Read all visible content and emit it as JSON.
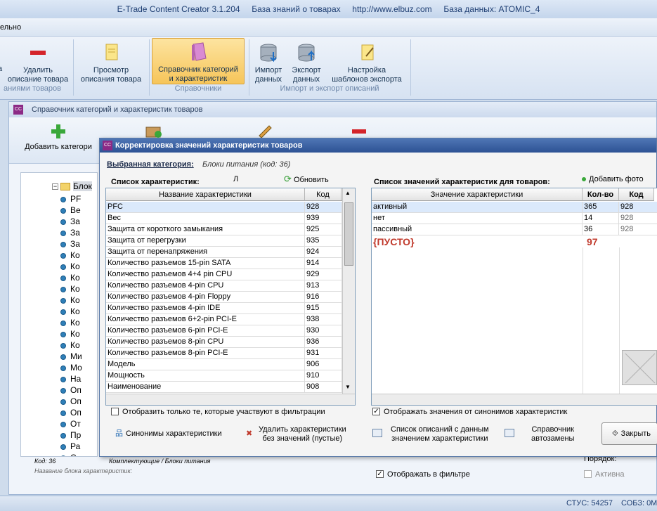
{
  "window": {
    "title": "E-Trade Content Creator 3.1.204     База знаний о товарах     http://www.elbuz.com     База данных: ATOMIC_4"
  },
  "menu": {
    "item": "ельно"
  },
  "ribbon": {
    "buttons": [
      {
        "label": "а",
        "icon": "partial-icon"
      },
      {
        "label": "Удалить\nописание товара",
        "icon": "minus-icon"
      },
      {
        "label": "Просмотр\nописания товара",
        "icon": "document-icon"
      },
      {
        "label": "Справочник категорий\nи характеристик",
        "icon": "book-icon"
      },
      {
        "label": "Импорт\nданных",
        "icon": "database-import-icon"
      },
      {
        "label": "Экспорт\nданных",
        "icon": "database-export-icon"
      },
      {
        "label": "Настройка\nшаблонов экспорта",
        "icon": "template-icon"
      }
    ],
    "groups": [
      "аниями товаров",
      "Справочники",
      "Импорт и экспорт описаний"
    ]
  },
  "mdi": {
    "title": "Справочник категорий и характеристик товаров",
    "add_category": "Добавить категори",
    "tree_root": "Блок",
    "tree_items": [
      "PF",
      "Ве",
      "За",
      "За",
      "За",
      "Ко",
      "Ко",
      "Ко",
      "Ко",
      "Ко",
      "Ко",
      "Ко",
      "Ко",
      "Ко",
      "Ми",
      "Мо",
      "На",
      "Оп",
      "Оп",
      "Оп",
      "От",
      "Пр",
      "Ра",
      "С"
    ],
    "code_label": "Код: 36",
    "path": "Комплектующие / Блоки питания",
    "name_label": "Название блока характеристик:",
    "order_label": "Порядок:",
    "show_in_filter": "Отображать в фильтре",
    "active": "Активна"
  },
  "dialog": {
    "title": "Корректировка значений характеристик товаров",
    "selected_label": "Выбранная категория:",
    "selected_value": "Блоки питания (код: 36)",
    "char_list_label": "Список характеристик:",
    "l_char": "Л",
    "refresh": "Обновить",
    "values_label": "Список значений характеристик для товаров:",
    "add_photo": "Добавить фото",
    "char_headers": [
      "Название характеристики",
      "Код"
    ],
    "chars": [
      [
        "PFC",
        "928"
      ],
      [
        "Вес",
        "939"
      ],
      [
        "Защита от короткого замыкания",
        "925"
      ],
      [
        "Защита от перегрузки",
        "935"
      ],
      [
        "Защита от перенапряжения",
        "924"
      ],
      [
        "Количество разъемов 15-pin SATA",
        "914"
      ],
      [
        "Количество разъемов 4+4 pin CPU",
        "929"
      ],
      [
        "Количество разъемов 4-pin CPU",
        "913"
      ],
      [
        "Количество разъемов 4-pin Floppy",
        "916"
      ],
      [
        "Количество разъемов 4-pin IDE",
        "915"
      ],
      [
        "Количество разъемов 6+2-pin PCI-E",
        "938"
      ],
      [
        "Количество разъемов 6-pin PCI-E",
        "930"
      ],
      [
        "Количество разъемов 8-pin CPU",
        "936"
      ],
      [
        "Количество разъемов 8-pin PCI-E",
        "931"
      ],
      [
        "Модель",
        "906"
      ],
      [
        "Мощность",
        "910"
      ],
      [
        "Наименование",
        "908"
      ]
    ],
    "value_headers": [
      "Значение характеристики",
      "Кол-во",
      "Код"
    ],
    "values": [
      [
        "активный",
        "365",
        "928"
      ],
      [
        "нет",
        "14",
        "928"
      ],
      [
        "пассивный",
        "36",
        "928"
      ]
    ],
    "empty_value": "{ПУСТО}",
    "empty_count": "97",
    "filter_only": "Отобразить только те, которые участвуют в фильтрации",
    "show_synonyms": "Отображать значения от синонимов характеристик",
    "synonyms": "Синонимы характеристики",
    "delete_empty": "Удалить характеристики\nбез значений (пустые)",
    "desc_list": "Список описаний с данным\nзначением характеристики",
    "autoreplace": "Справочник\nавтозамены",
    "close": "Закрыть"
  },
  "statusbar": {
    "items": [
      "СТУС: 54257",
      "СОБЗ: 0",
      "М"
    ]
  }
}
